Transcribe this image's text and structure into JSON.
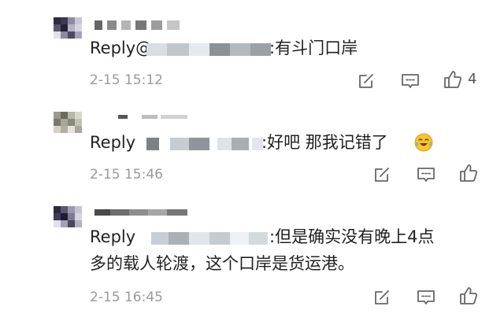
{
  "comments": [
    {
      "reply_prefix": "Reply@",
      "reply_text": ":有斗门口岸",
      "time": "2-15 15:12",
      "like_count": "4",
      "icons": [
        "edit-icon",
        "comment-icon",
        "like-icon"
      ]
    },
    {
      "reply_prefix": "Reply",
      "reply_text": ":好吧 那我记错了",
      "time": "2-15 15:46",
      "like_count": "",
      "emoji": "crying-laughing-emoji",
      "icons": [
        "edit-icon",
        "comment-icon",
        "like-icon"
      ]
    },
    {
      "reply_prefix": "Reply",
      "reply_text_line1": ":但是确实没有晚上4点",
      "reply_text_line2": "多的载人轮渡，这个口岸是货运港。",
      "time": "2-15 16:45",
      "like_count": "",
      "icons": [
        "edit-icon",
        "comment-icon",
        "like-icon"
      ]
    }
  ],
  "colors": {
    "text": "#222222",
    "meta": "#9a9a9a",
    "icon": "#666666"
  }
}
